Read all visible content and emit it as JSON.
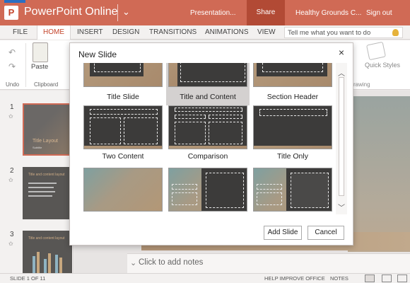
{
  "titlebar": {
    "logo": "P",
    "app_name": "PowerPoint Online",
    "chevron": "⌄",
    "doc_name": "Presentation...",
    "share": "Share",
    "user": "Healthy Grounds C...",
    "signout": "Sign out"
  },
  "tabs": [
    "FILE",
    "HOME",
    "INSERT",
    "DESIGN",
    "TRANSITIONS",
    "ANIMATIONS",
    "VIEW"
  ],
  "active_tab": "HOME",
  "tellme_placeholder": "Tell me what you want to do",
  "ribbon": {
    "paste": "Paste",
    "undo_group": "Undo",
    "clipboard_group": "Clipboard",
    "quick_styles": "Quick Styles",
    "ge_fragment": "ge",
    "drawing_group": "rawing"
  },
  "thumbnails": [
    {
      "num": "1",
      "title": "Title Layout",
      "subtitle": "Subtitle"
    },
    {
      "num": "2",
      "title": "Title and content layout"
    },
    {
      "num": "3",
      "title": "Title and content layout"
    }
  ],
  "notes_placeholder": "Click to add notes",
  "status": {
    "slide_count": "SLIDE 1 OF 11",
    "help": "HELP IMPROVE OFFICE",
    "notes": "NOTES"
  },
  "dialog": {
    "title": "New Slide",
    "close": "×",
    "layouts": [
      {
        "label": "Title Slide"
      },
      {
        "label": "Title and Content",
        "selected": true
      },
      {
        "label": "Section Header"
      },
      {
        "label": "Two Content"
      },
      {
        "label": "Comparison"
      },
      {
        "label": "Title Only"
      }
    ],
    "add_button": "Add Slide",
    "cancel_button": "Cancel"
  },
  "colors": {
    "accent": "#d06a55",
    "accent_dark": "#b24a35",
    "slide_dark": "#3c3b3a",
    "slide_tan": "#b49a7c"
  }
}
